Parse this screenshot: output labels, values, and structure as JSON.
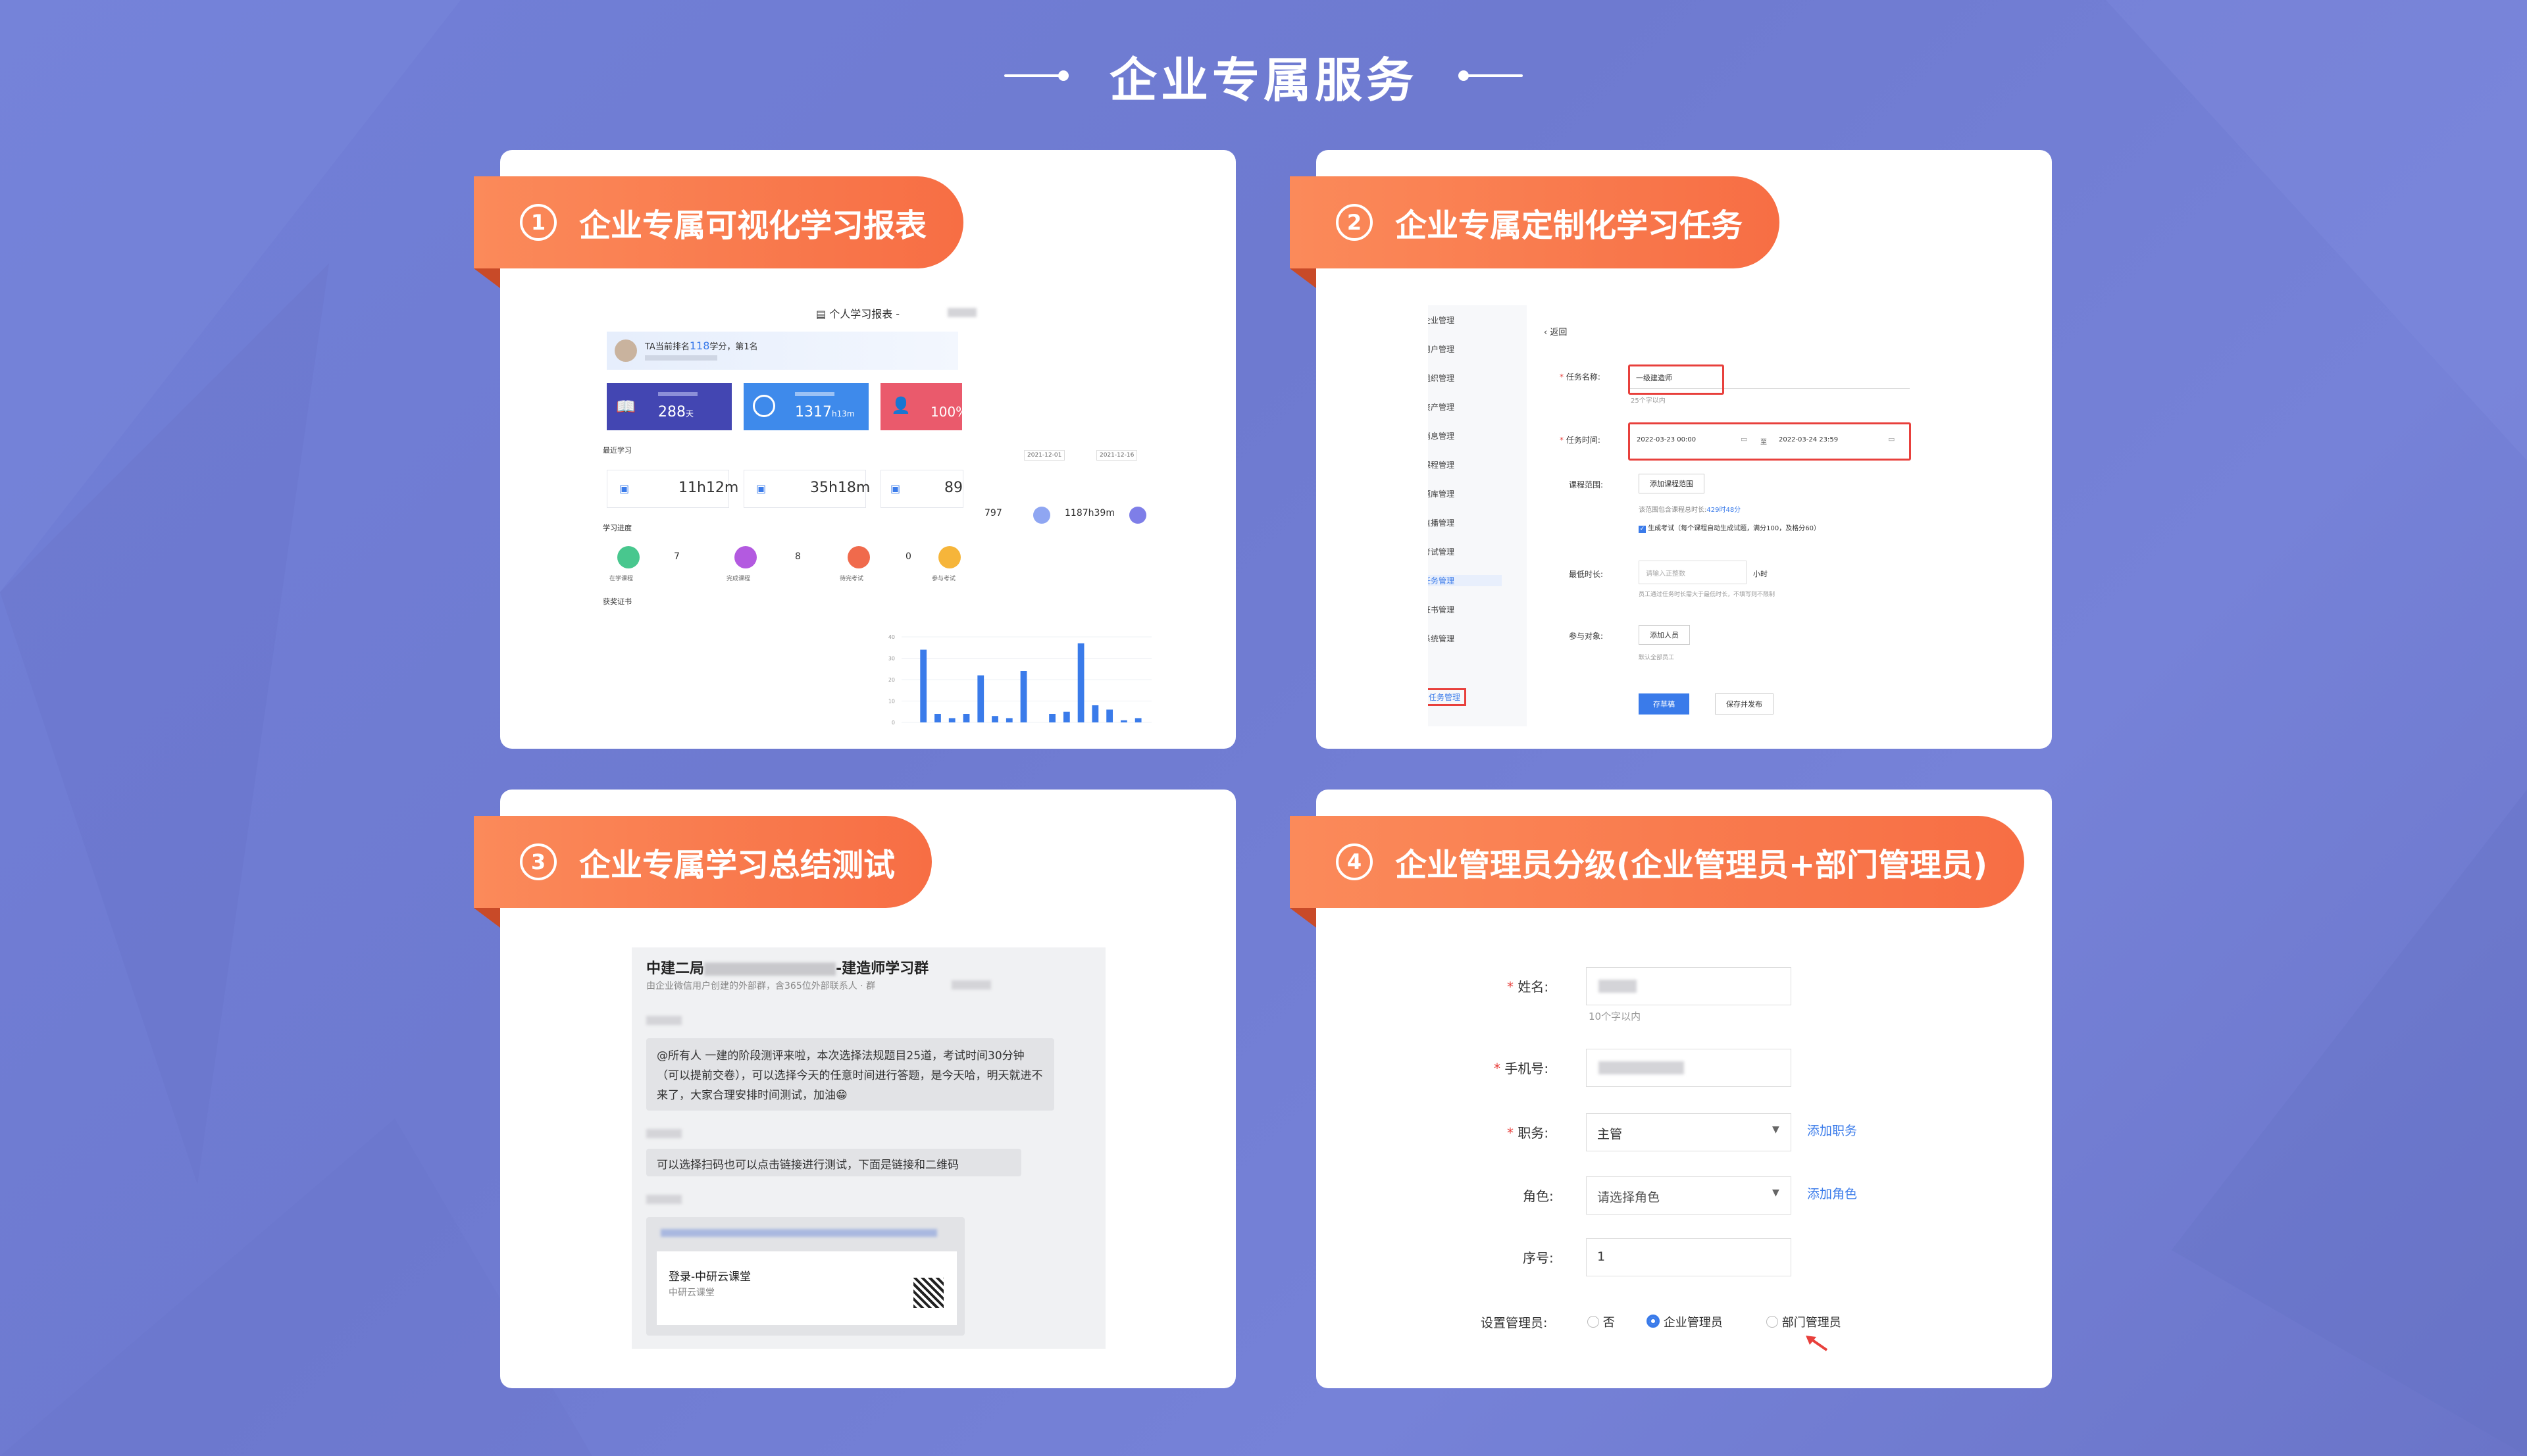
{
  "page": {
    "title": "企业专属服务"
  },
  "cards": [
    {
      "num": "1",
      "title": "企业专属可视化学习报表"
    },
    {
      "num": "2",
      "title": "企业专属定制化学习任务"
    },
    {
      "num": "3",
      "title": "企业专属学习总结测试"
    },
    {
      "num": "4",
      "title": "企业管理员分级(企业管理员+部门管理员)"
    }
  ],
  "report": {
    "header": "个人学习报表 -",
    "rank_a": "TA当前排名",
    "rank_num": "118",
    "rank_b": "学分，第",
    "rank_pos": "1",
    "rank_c": "名",
    "stat1_value": "288",
    "stat1_unit": "天",
    "stat2_value": "1317",
    "stat2_unit": "h13m",
    "stat3_value": "100%",
    "recent_label": "最近学习",
    "date_from": "2021-12-01",
    "date_to": "2021-12-16",
    "today_value": "11h12m",
    "week_value": "35h18m",
    "month_value": "89",
    "right_val1": "797",
    "right_val2": "1187h39m",
    "progress_label": "学习进度",
    "prog_values": [
      "7",
      "8",
      "0"
    ],
    "prog_labels": [
      "在学课程",
      "完成课程",
      "待完考试",
      "参与考试"
    ],
    "cert_label": "获奖证书",
    "chart_yticks": [
      "40",
      "30",
      "20",
      "10",
      "0"
    ]
  },
  "chart_data": {
    "type": "bar",
    "title": "",
    "xlabel": "",
    "ylabel": "",
    "ylim": [
      0,
      40
    ],
    "values": [
      0,
      34,
      4,
      2,
      4,
      22,
      3,
      2,
      24,
      0,
      4,
      5,
      37,
      8,
      6,
      1,
      2
    ]
  },
  "task": {
    "sidebar": [
      "企业管理",
      "用户管理",
      "组织管理",
      "资产管理",
      "消息管理",
      "课程管理",
      "题库管理",
      "直播管理",
      "考试管理",
      "任务管理",
      "证书管理",
      "系统管理",
      "任务管理"
    ],
    "back": "返回",
    "name_label": "任务名称:",
    "name_value": "一级建造师",
    "name_hint": "25个字以内",
    "time_label": "任务时间:",
    "start_time": "2022-03-23 00:00",
    "to": "至",
    "end_time": "2022-03-24 23:59",
    "scope_label": "课程范围:",
    "add_scope": "添加课程范围",
    "scope_info_a": "该范围包含课程总时长:",
    "scope_info_b": "429时48分",
    "exam_check": "生成考试（每个课程自动生成试题，满分100，及格分60）",
    "min_label": "最低时长:",
    "min_placeholder": "请输入正整数",
    "min_unit": "小时",
    "min_hint": "员工通过任务时长需大于最低时长，不填写则不限制",
    "join_label": "参与对象:",
    "add_people": "添加人员",
    "join_hint": "默认全部员工",
    "draft_btn": "存草稿",
    "publish_btn": "保存并发布"
  },
  "chat": {
    "group_prefix": "中建二局",
    "group_suffix": "-建造师学习群",
    "group_sub": "由企业微信用户创建的外部群，含365位外部联系人 · 群",
    "msg1": "@所有人  一建的阶段测评来啦，本次选择法规题目25道，考试时间30分钟（可以提前交卷），可以选择今天的任意时间进行答题，是今天哈，明天就进不来了，大家合理安排时间测试，加油",
    "msg2": "可以选择扫码也可以点击链接进行测试，下面是链接和二维码",
    "link_title": "登录-中研云课堂",
    "link_sub": "中研云课堂",
    "emoji": "😁"
  },
  "admin": {
    "name_label": "姓名:",
    "name_hint": "10个字以内",
    "phone_label": "手机号:",
    "role_label": "职务:",
    "role_value": "主管",
    "add_role": "添加职务",
    "char_label": "角色:",
    "char_placeholder": "请选择角色",
    "add_char": "添加角色",
    "order_label": "序号:",
    "order_value": "1",
    "mgr_label": "设置管理员:",
    "opt_no": "否",
    "opt_ent": "企业管理员",
    "opt_dept": "部门管理员"
  },
  "colors": {
    "accent": "#f76e44",
    "blue": "#3a7bea",
    "purple": "#4c4fc6",
    "red": "#e8403c"
  }
}
